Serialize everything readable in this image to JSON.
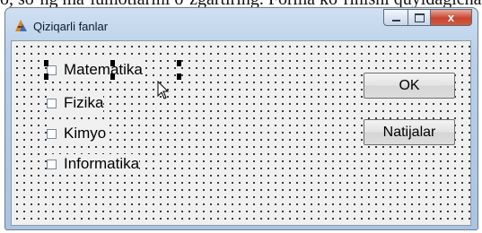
{
  "page": {
    "top_text": "ö, so‘ng ma’lumotlarini o‘zgartiring. Forma ko‘rinishi quyidagicha b"
  },
  "window": {
    "title": "Qiziqarli fanlar",
    "controls": {
      "minimize": "minimize",
      "maximize": "maximize",
      "close": "x"
    }
  },
  "checkboxes": [
    {
      "label": "Matematika",
      "checked": false,
      "selected": true
    },
    {
      "label": "Fizika",
      "checked": false,
      "selected": false
    },
    {
      "label": "Kimyo",
      "checked": false,
      "selected": false
    },
    {
      "label": "Informatika",
      "checked": false,
      "selected": false
    }
  ],
  "buttons": {
    "ok": "OK",
    "results": "Natijalar"
  },
  "icons": {
    "app": "delphi-helmet-icon",
    "cursor": "mouse-pointer-icon"
  }
}
